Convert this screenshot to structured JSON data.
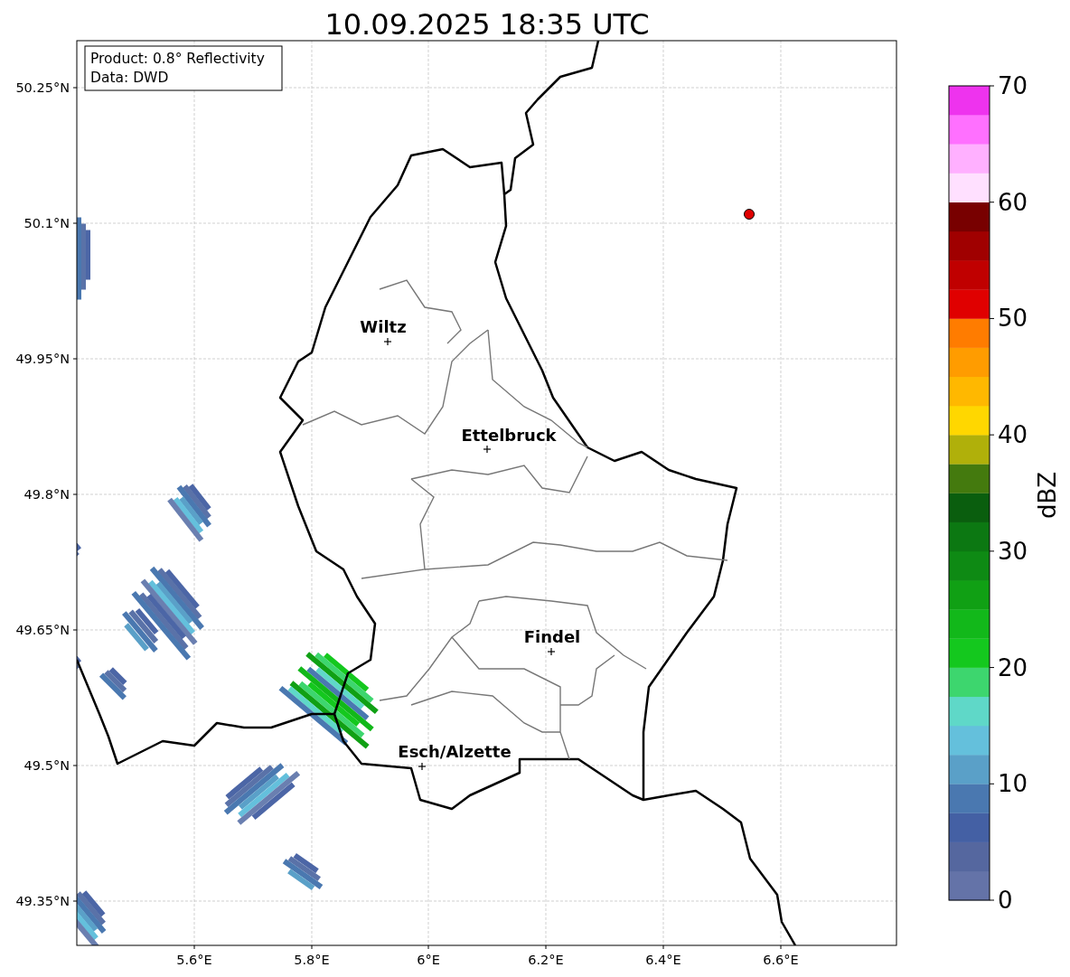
{
  "title": "10.09.2025 18:35 UTC",
  "legend": [
    "Product: 0.8° Reflectivity",
    "Data: DWD"
  ],
  "map": {
    "lat_ticks": [
      "50.25°N",
      "50.1°N",
      "49.95°N",
      "49.8°N",
      "49.65°N",
      "49.5°N",
      "49.35°N"
    ],
    "lon_ticks": [
      "5.6°E",
      "5.8°E",
      "6°E",
      "6.2°E",
      "6.4°E",
      "6.6°E"
    ],
    "places": [
      {
        "name": "Wiltz"
      },
      {
        "name": "Ettelbruck"
      },
      {
        "name": "Findel"
      },
      {
        "name": "Esch/Alzette"
      }
    ]
  },
  "colorbar": {
    "label": "dBZ",
    "ticks": [
      "70",
      "60",
      "50",
      "40",
      "30",
      "20",
      "10",
      "0"
    ],
    "bins": [
      {
        "color": "#6473a8"
      },
      {
        "color": "#55679f"
      },
      {
        "color": "#4460a4"
      },
      {
        "color": "#4a78b0"
      },
      {
        "color": "#5aa0c8"
      },
      {
        "color": "#64c0dc"
      },
      {
        "color": "#5fd8c8"
      },
      {
        "color": "#3dd66e"
      },
      {
        "color": "#14c81e"
      },
      {
        "color": "#12b81a"
      },
      {
        "color": "#10a014"
      },
      {
        "color": "#0e8a14"
      },
      {
        "color": "#0c7812"
      },
      {
        "color": "#0a5e0e"
      },
      {
        "color": "#447a0e"
      },
      {
        "color": "#b0b00a"
      },
      {
        "color": "#ffd700"
      },
      {
        "color": "#ffb800"
      },
      {
        "color": "#ff9c00"
      },
      {
        "color": "#ff7c00"
      },
      {
        "color": "#e00000"
      },
      {
        "color": "#c00000"
      },
      {
        "color": "#a00000"
      },
      {
        "color": "#780000"
      },
      {
        "color": "#ffe0ff"
      },
      {
        "color": "#ffb0ff"
      },
      {
        "color": "#ff70ff"
      },
      {
        "color": "#ee33ee"
      }
    ]
  }
}
